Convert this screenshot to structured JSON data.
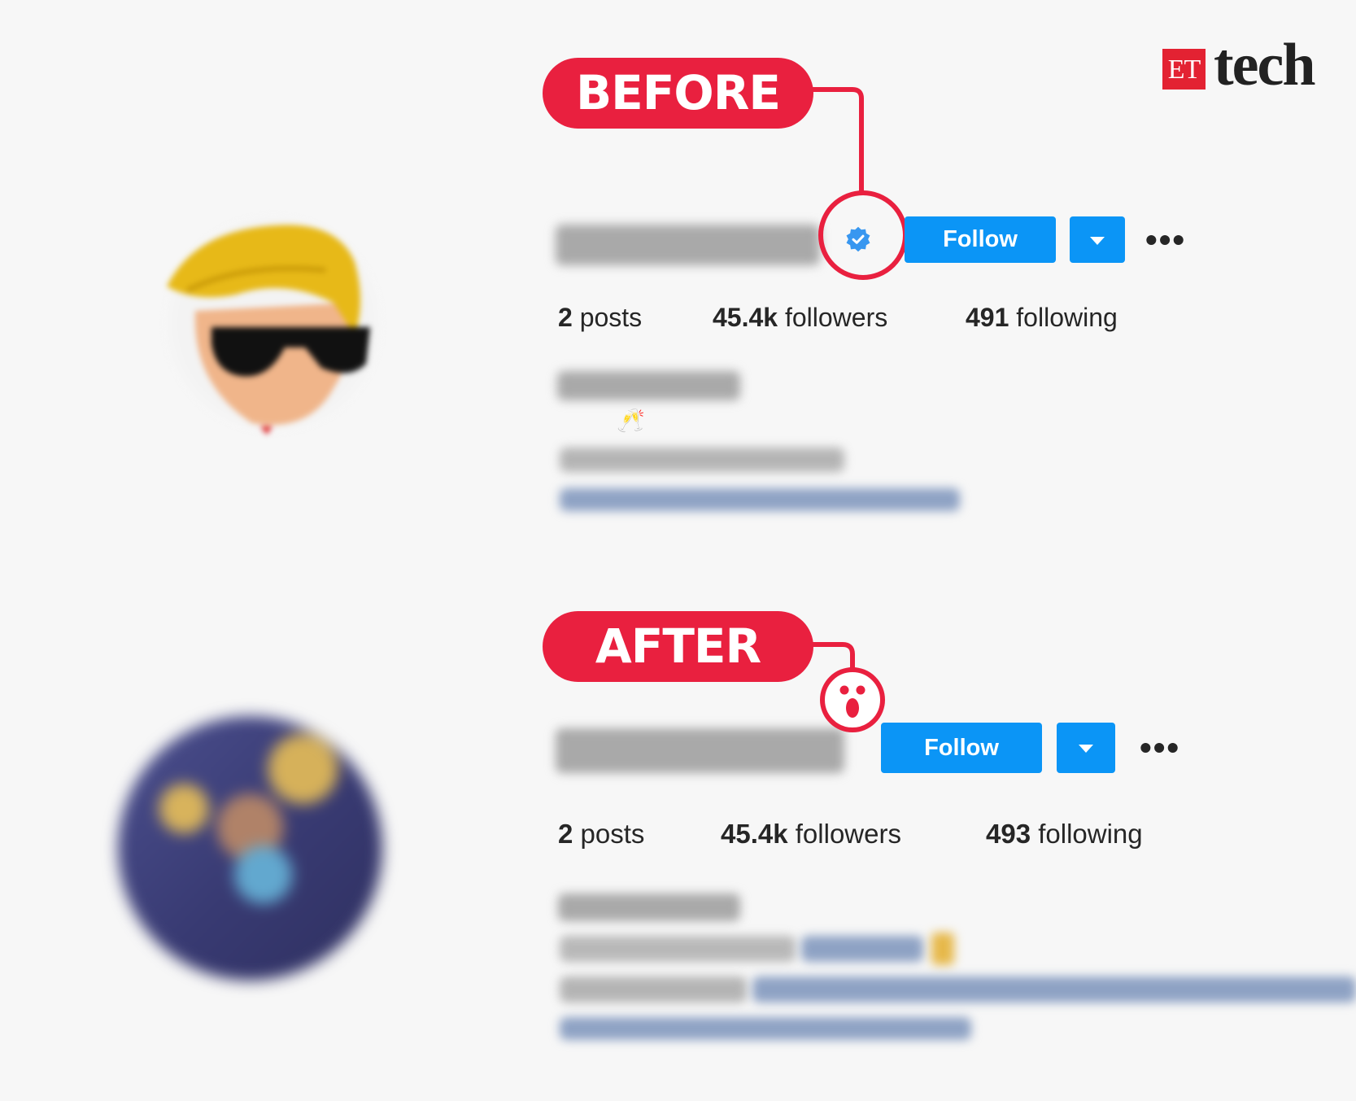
{
  "logo": {
    "et": "ET",
    "tech": "tech"
  },
  "before": {
    "label": "BEFORE",
    "follow_label": "Follow",
    "more_label": "•••",
    "stats": {
      "posts_count": "2",
      "posts_label": " posts",
      "followers_count": "45.4k",
      "followers_label": " followers",
      "following_count": "491",
      "following_label": " following"
    },
    "bio_emoji": "🥂",
    "verified": true
  },
  "after": {
    "label": "AFTER",
    "follow_label": "Follow",
    "more_label": "•••",
    "stats": {
      "posts_count": "2",
      "posts_label": " posts",
      "followers_count": "45.4k",
      "followers_label": " followers",
      "following_count": "493",
      "following_label": " following"
    },
    "verified": false
  },
  "colors": {
    "accent_red": "#e9203f",
    "follow_blue": "#0b95f6",
    "verified_blue": "#3897f0"
  }
}
